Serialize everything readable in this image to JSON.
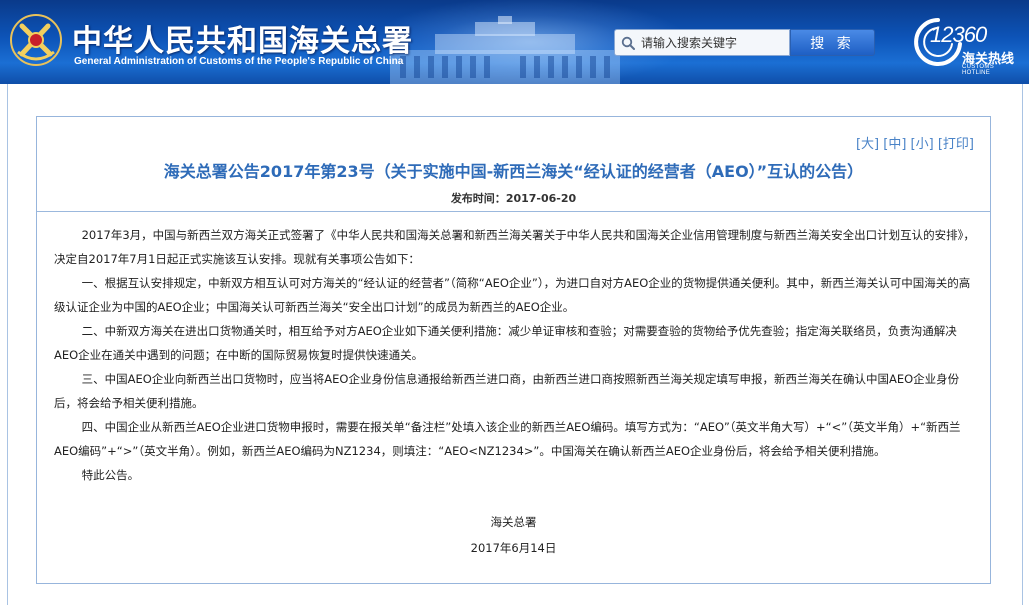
{
  "header": {
    "site_title": "中华人民共和国海关总署",
    "site_subtitle": "General Administration of Customs of the People's Republic of China",
    "search_placeholder": "请输入搜索关键字",
    "search_button": "搜 索",
    "hotline_number": "12360",
    "hotline_label": "海关热线",
    "hotline_en": "CUSTOMS HOTLINE"
  },
  "toolbar": {
    "size_large": "[大]",
    "size_medium": "[中]",
    "size_small": "[小]",
    "print": "[打印]"
  },
  "article": {
    "title": "海关总署公告2017年第23号（关于实施中国-新西兰海关“经认证的经营者（AEO）”互认的公告）",
    "publish_label": "发布时间：",
    "publish_date": "2017-06-20",
    "paragraphs": [
      "2017年3月，中国与新西兰双方海关正式签署了《中华人民共和国海关总署和新西兰海关署关于中华人民共和国海关企业信用管理制度与新西兰海关安全出口计划互认的安排》，决定自2017年7月1日起正式实施该互认安排。现就有关事项公告如下：",
      "一、根据互认安排规定，中新双方相互认可对方海关的“经认证的经营者”（简称“AEO企业”），为进口自对方AEO企业的货物提供通关便利。其中，新西兰海关认可中国海关的高级认证企业为中国的AEO企业；中国海关认可新西兰海关“安全出口计划”的成员为新西兰的AEO企业。",
      "二、中新双方海关在进出口货物通关时，相互给予对方AEO企业如下通关便利措施：减少单证审核和查验；对需要查验的货物给予优先查验；指定海关联络员，负责沟通解决AEO企业在通关中遇到的问题；在中断的国际贸易恢复时提供快速通关。",
      "三、中国AEO企业向新西兰出口货物时，应当将AEO企业身份信息通报给新西兰进口商，由新西兰进口商按照新西兰海关规定填写申报，新西兰海关在确认中国AEO企业身份后，将会给予相关便利措施。",
      "四、中国企业从新西兰AEO企业进口货物申报时，需要在报关单“备注栏”处填入该企业的新西兰AEO编码。填写方式为：“AEO”（英文半角大写）+“<”（英文半角）+“新西兰AEO编码”+“>”（英文半角）。例如，新西兰AEO编码为NZ1234，则填注：“AEO<NZ1234>”。中国海关在确认新西兰AEO企业身份后，将会给予相关便利措施。",
      "特此公告。"
    ],
    "signature": "海关总署",
    "signature_date": "2017年6月14日"
  },
  "colors": {
    "header_blue": "#0d54b8",
    "title_blue": "#2e6bb8",
    "link_blue": "#4a83c7",
    "frame_border": "#97b5dc"
  }
}
